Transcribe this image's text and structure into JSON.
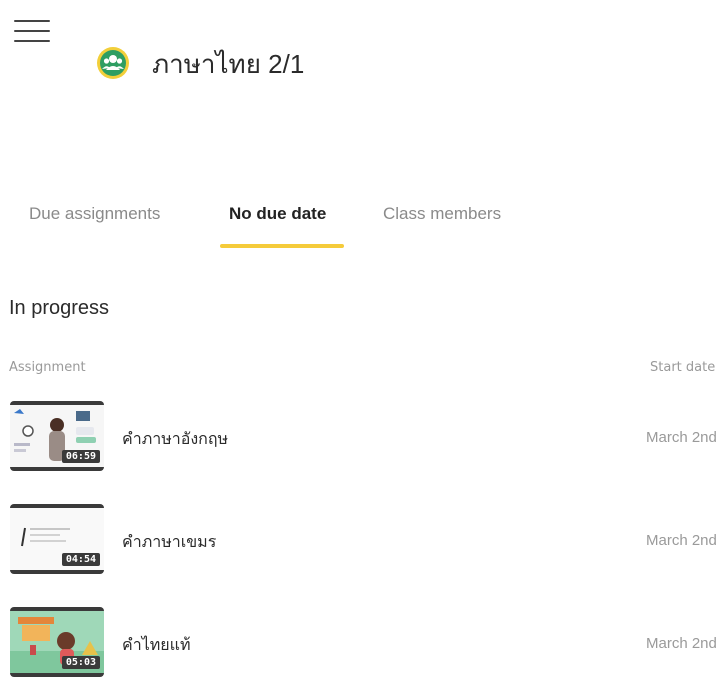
{
  "header": {
    "menu_icon": "hamburger-menu-icon",
    "class_icon": "class-group-icon",
    "class_title": "ภาษาไทย 2/1",
    "avatar_color": "#2e9e62",
    "avatar_ring": "#f2cf3a"
  },
  "tabs": [
    {
      "label": "Due assignments",
      "active": false
    },
    {
      "label": "No due date",
      "active": true
    },
    {
      "label": "Class members",
      "active": false
    }
  ],
  "accent_color": "#f5cb3a",
  "section": {
    "title": "In progress"
  },
  "columns": {
    "assignment": "Assignment",
    "start_date": "Start date"
  },
  "assignments": [
    {
      "title": "คำภาษาอังกฤษ",
      "duration": "06:59",
      "start_date": "March 2nd"
    },
    {
      "title": "คำภาษาเขมร",
      "duration": "04:54",
      "start_date": "March 2nd"
    },
    {
      "title": "คำไทยแท้",
      "duration": "05:03",
      "start_date": "March 2nd"
    }
  ]
}
